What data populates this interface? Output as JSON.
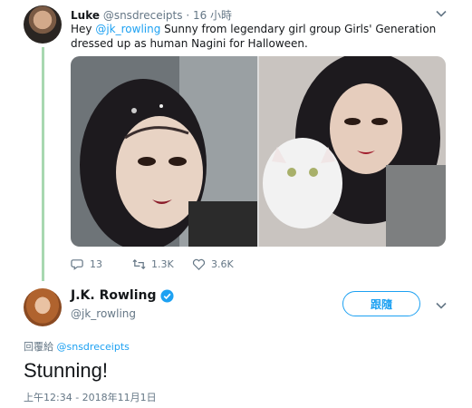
{
  "parent_tweet": {
    "name": "Luke",
    "handle": "@snsdreceipts",
    "time": "· 16 小時",
    "text_before": "Hey ",
    "mention": "@jk_rowling",
    "text_after": " Sunny from legendary girl group Girls' Generation dressed up as human Nagini for Halloween.",
    "replies": "13",
    "retweets": "1.3K",
    "likes": "3.6K"
  },
  "reply_tweet": {
    "name": "J.K. Rowling",
    "handle": "@jk_rowling",
    "follow_label": "跟隨",
    "replying_prefix": "回覆給 ",
    "replying_to": "@snsdreceipts",
    "text": "Stunning!",
    "timestamp": "上午12:34 - 2018年11月1日"
  },
  "icons": {
    "reply": "reply-icon",
    "retweet": "retweet-icon",
    "like": "heart-icon",
    "verified": "verified-badge-icon",
    "menu": "chevron-down-icon"
  },
  "colors": {
    "accent": "#1da1f2",
    "text": "#14171a",
    "muted": "#657786",
    "thread_line": "#a8d8b0"
  }
}
